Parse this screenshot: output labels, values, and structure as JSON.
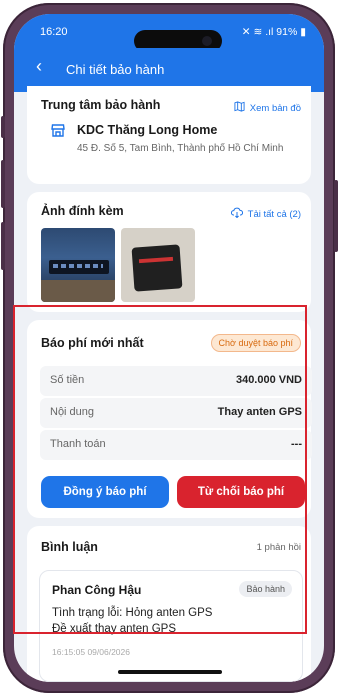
{
  "status_bar": {
    "time": "16:20",
    "indicators": "✕ ≋ .ıl 91% ▮"
  },
  "app_bar": {
    "title": "Chi tiết bảo hành"
  },
  "service_center": {
    "section_title": "Trung tâm bảo hành",
    "map_link": "Xem bản đồ",
    "name": "KDC Thăng Long Home",
    "address": "45 Đ. Số 5, Tam Bình, Thành phố Hồ Chí Minh"
  },
  "attachments": {
    "section_title": "Ảnh đính kèm",
    "download_all": "Tải tất cả (2)"
  },
  "fee": {
    "section_title": "Báo phí mới nhất",
    "status": "Chờ duyệt báo phí",
    "rows": [
      {
        "label": "Số tiền",
        "value": "340.000 VND"
      },
      {
        "label": "Nội dung",
        "value": "Thay anten GPS"
      },
      {
        "label": "Thanh toán",
        "value": "---"
      }
    ],
    "accept_label": "Đồng ý báo phí",
    "reject_label": "Từ chối báo phí"
  },
  "comments": {
    "section_title": "Bình luận",
    "count": "1 phản hồi",
    "items": [
      {
        "author": "Phan Công Hậu",
        "role": "Bảo hành",
        "line1": "Tình trạng lỗi: Hỏng anten GPS",
        "line2": "Đề xuất thay anten GPS",
        "time": "16:15:05 09/06/2026"
      }
    ]
  },
  "colors": {
    "primary": "#1f75e8",
    "danger": "#d9232e",
    "badge_bg": "#fde8d3",
    "badge_text": "#d86a0f"
  }
}
